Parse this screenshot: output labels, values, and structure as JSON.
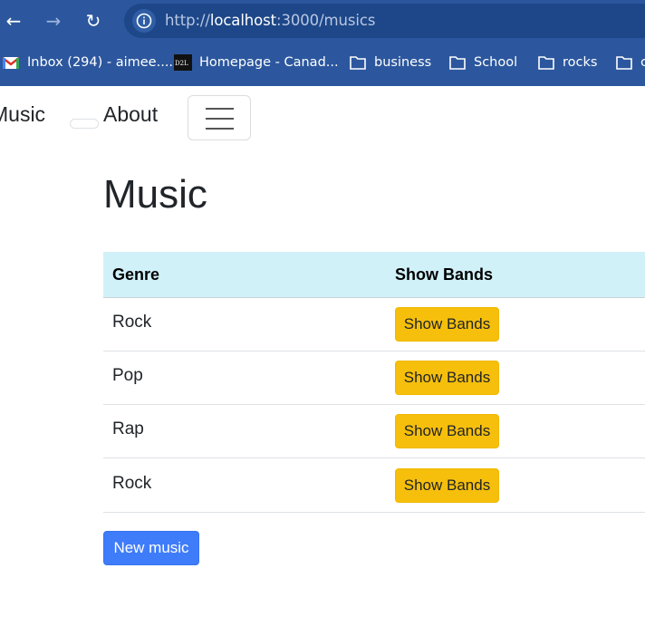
{
  "browser": {
    "url_scheme": "http://",
    "url_host": "localhost",
    "url_rest": ":3000/musics",
    "bookmarks": [
      {
        "label": "Inbox (294) - aimee....",
        "icon": "gmail-icon"
      },
      {
        "label": "Homepage - Canad...",
        "icon": "d2l-icon",
        "icon_text": "D2L"
      },
      {
        "label": "business",
        "icon": "folder-icon"
      },
      {
        "label": "School",
        "icon": "folder-icon"
      },
      {
        "label": "rocks",
        "icon": "folder-icon"
      },
      {
        "label": "c",
        "icon": "folder-icon"
      }
    ]
  },
  "navbar": {
    "brand": "Music",
    "about": "About",
    "toggler_icon": "hamburger-icon"
  },
  "page": {
    "title": "Music"
  },
  "table": {
    "headers": [
      "Genre",
      "Show Bands"
    ],
    "rows": [
      {
        "genre": "Rock",
        "action": "Show Bands"
      },
      {
        "genre": "Pop",
        "action": "Show Bands"
      },
      {
        "genre": "Rap",
        "action": "Show Bands"
      },
      {
        "genre": "Rock",
        "action": "Show Bands"
      }
    ]
  },
  "actions": {
    "new_music": "New music"
  },
  "colors": {
    "chrome": "#2c579e",
    "table_header": "#d1f1f9",
    "warning_button": "#f6bf0c",
    "primary_button": "#3f7cfa"
  }
}
